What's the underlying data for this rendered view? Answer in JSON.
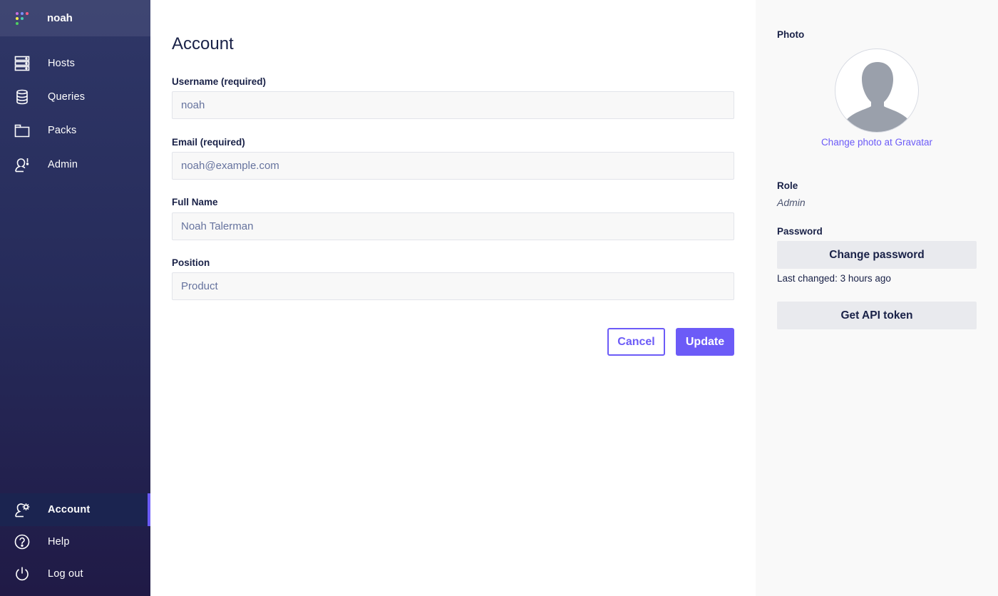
{
  "sidebar": {
    "username": "noah",
    "nav": [
      {
        "label": "Hosts",
        "icon": "hosts-icon"
      },
      {
        "label": "Queries",
        "icon": "database-icon"
      },
      {
        "label": "Packs",
        "icon": "folder-icon"
      },
      {
        "label": "Admin",
        "icon": "admin-user-icon"
      }
    ],
    "bottom": [
      {
        "label": "Account",
        "icon": "account-gear-icon",
        "active": true
      },
      {
        "label": "Help",
        "icon": "help-icon"
      },
      {
        "label": "Log out",
        "icon": "power-icon"
      }
    ]
  },
  "main": {
    "title": "Account",
    "fields": {
      "username": {
        "label": "Username (required)",
        "value": "noah"
      },
      "email": {
        "label": "Email (required)",
        "value": "noah@example.com"
      },
      "full_name": {
        "label": "Full Name",
        "value": "Noah Talerman"
      },
      "position": {
        "label": "Position",
        "value": "Product"
      }
    },
    "cancel_label": "Cancel",
    "update_label": "Update"
  },
  "panel": {
    "photo_label": "Photo",
    "gravatar_link": "Change photo at Gravatar",
    "role_label": "Role",
    "role_value": "Admin",
    "password_label": "Password",
    "change_password_label": "Change password",
    "last_changed": "Last changed: 3 hours ago",
    "api_token_label": "Get API token"
  },
  "colors": {
    "accent": "#6c5bf7",
    "sidebar": "#262b5a",
    "text": "#192147"
  }
}
